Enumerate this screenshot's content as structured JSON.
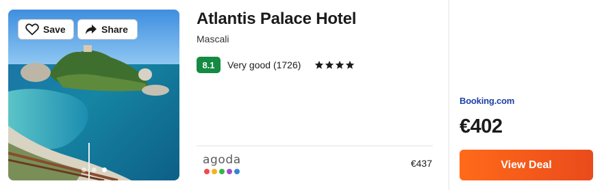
{
  "hotel": {
    "name": "Atlantis Palace Hotel",
    "location": "Mascali",
    "score": "8.1",
    "rating_text": "Very good (1726)",
    "stars": 4
  },
  "photo": {
    "save_label": "Save",
    "share_label": "Share",
    "icons": [
      "heart-icon",
      "share-arrow-icon"
    ],
    "slides_shown": 3,
    "active_slide": 3
  },
  "alt_provider": {
    "name": "agoda",
    "price": "€437",
    "dot_colors": [
      "#ef4b4b",
      "#f6b31b",
      "#3bb34a",
      "#a24bc8",
      "#2f86d6"
    ]
  },
  "deal": {
    "site": "Booking.com",
    "price": "€402",
    "button_label": "View Deal"
  },
  "colors": {
    "score_badge": "#158a42",
    "deal_site": "#1d3fa8",
    "button_start": "#ff6a1a",
    "button_end": "#ea4b1b"
  }
}
